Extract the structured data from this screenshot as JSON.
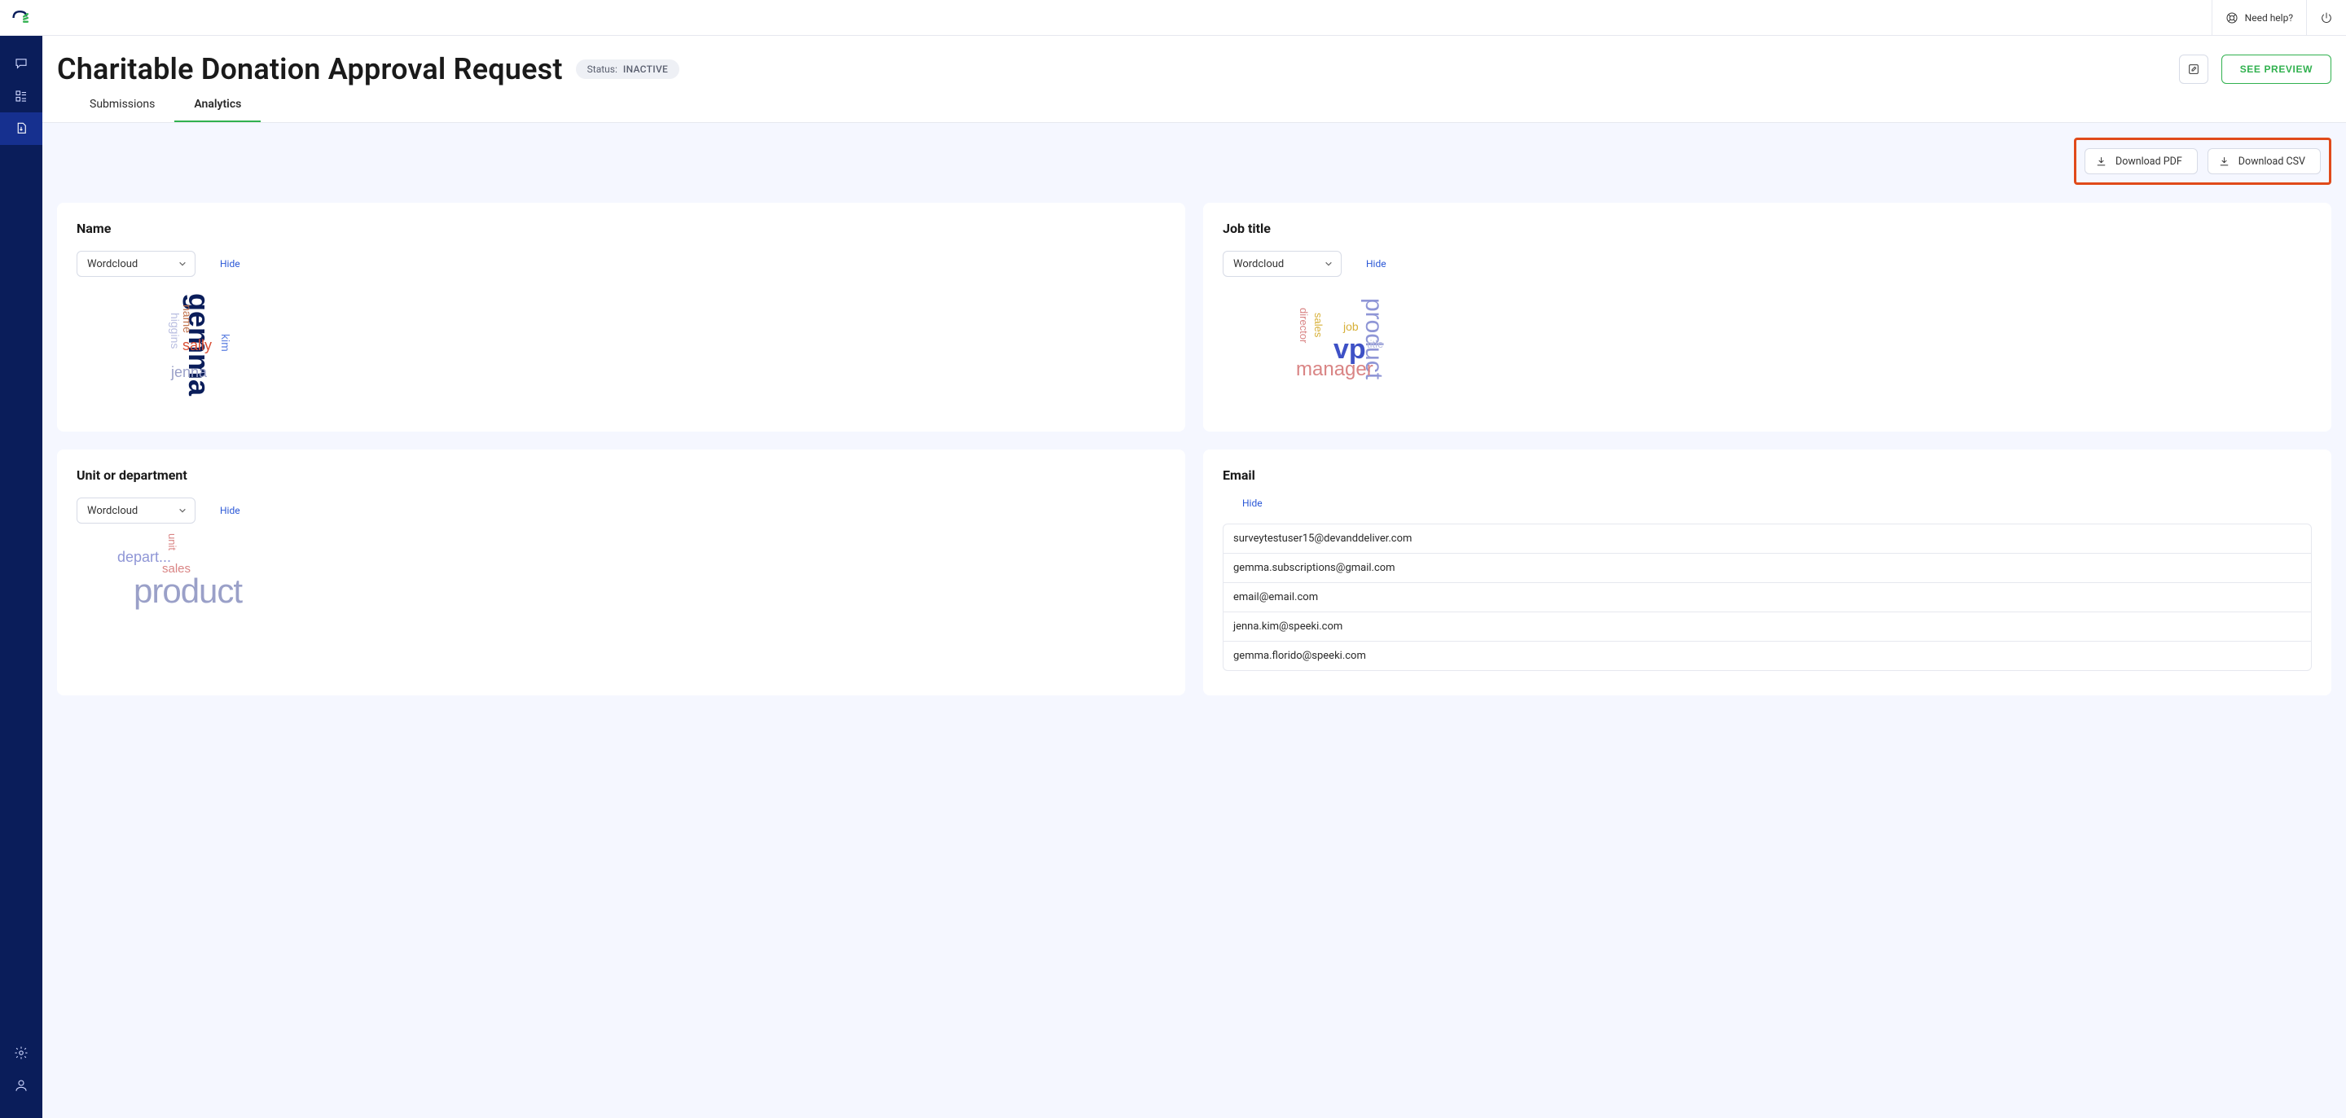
{
  "brand": "Speeki",
  "utilbar": {
    "help_label": "Need help?"
  },
  "header": {
    "title": "Charitable Donation Approval Request",
    "status_label": "Status:",
    "status_value": "INACTIVE",
    "see_preview": "SEE PREVIEW"
  },
  "tabs": {
    "submissions": "Submissions",
    "analytics": "Analytics",
    "active": "analytics"
  },
  "downloads": {
    "pdf": "Download PDF",
    "csv": "Download CSV"
  },
  "common": {
    "viz_select": "Wordcloud",
    "hide": "Hide"
  },
  "cards": {
    "name": {
      "title": "Name",
      "words": {
        "gemma": "gemma",
        "name": "name",
        "higgins": "higgins",
        "sally": "sally",
        "kim": "kim",
        "jenna": "jenna"
      }
    },
    "job_title": {
      "title": "Job title",
      "words": {
        "product": "product",
        "vp": "vp",
        "manager": "manager",
        "job": "job",
        "director": "director",
        "sales": "sales",
        "title": "title"
      }
    },
    "unit": {
      "title": "Unit or department",
      "words": {
        "product": "product",
        "depart": "depart...",
        "sales": "sales",
        "unit": "unit"
      }
    },
    "email": {
      "title": "Email",
      "rows": [
        "surveytestuser15@devanddeliver.com",
        "gemma.subscriptions@gmail.com",
        "email@email.com",
        "jenna.kim@speeki.com",
        "gemma.florido@speeki.com"
      ]
    }
  }
}
